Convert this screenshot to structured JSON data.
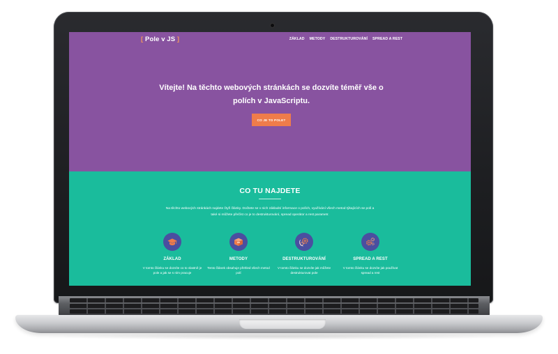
{
  "site": {
    "brand": {
      "open": "[",
      "name": "Pole v JS",
      "close": "]"
    },
    "nav": [
      "ZÁKLAD",
      "METODY",
      "DESTRUKTUROVÁNÍ",
      "SPREAD A REST"
    ],
    "hero": {
      "title": "Vítejte! Na těchto webových stránkách se dozvíte téměř vše o polích v JavaScriptu.",
      "cta": "CO JE TO POLE?"
    },
    "section": {
      "title": "CO TU NAJDETE",
      "intro": "Na těchto webových stránkách najdete čtyři články. Dočtete se v nich základní informace o polích, využívání všech metod týkajících se polí a také si můžete přečíst co je to destrukturování, spread operátor a rest parametr.",
      "features": [
        {
          "title": "ZÁKLAD",
          "icon": "graduation-cap-icon",
          "text": "V tomto článku se dozvíte co to vlastně je pole a jak se s ním pracuje"
        },
        {
          "title": "METODY",
          "icon": "box-icon",
          "text": "Tento článek obsahuje přehled všech metod polí"
        },
        {
          "title": "DESTRUKTUROVÁNÍ",
          "icon": "gears-icon",
          "text": "V tomto článku se dozvíte jak můžete destrukturovat pole"
        },
        {
          "title": "SPREAD A REST",
          "icon": "cogs-icon",
          "text": "V tomto článku se dozvíte jak používat spread a rest"
        }
      ]
    }
  },
  "colors": {
    "hero_bg": "#8853a0",
    "section_bg": "#1abc9c",
    "accent": "#ef7c4a",
    "icon_circle": "#4a4fa0"
  }
}
